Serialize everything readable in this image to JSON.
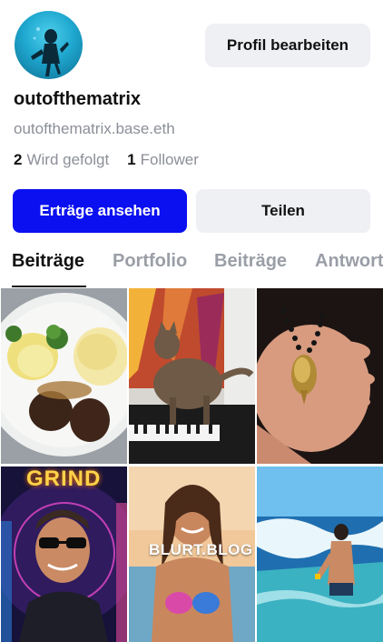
{
  "profile": {
    "username": "outofthematrix",
    "domain": "outofthematrix.base.eth",
    "following_count": "2",
    "following_label": "Wird gefolgt",
    "followers_count": "1",
    "followers_label": "Follower"
  },
  "actions": {
    "edit_label": "Profil bearbeiten",
    "earnings_label": "Erträge ansehen",
    "share_label": "Teilen"
  },
  "tabs": [
    {
      "label": "Beiträge",
      "active": true
    },
    {
      "label": "Portfolio",
      "active": false
    },
    {
      "label": "Beiträge",
      "active": false
    },
    {
      "label": "Antworten",
      "active": false
    }
  ],
  "grid": {
    "overlay_grind": "GRIND",
    "overlay_blurt": "BLURT.BLOG"
  },
  "colors": {
    "primary": "#0b10f0",
    "secondary_bg": "#eef0f3",
    "muted_text": "#8b8f98"
  }
}
